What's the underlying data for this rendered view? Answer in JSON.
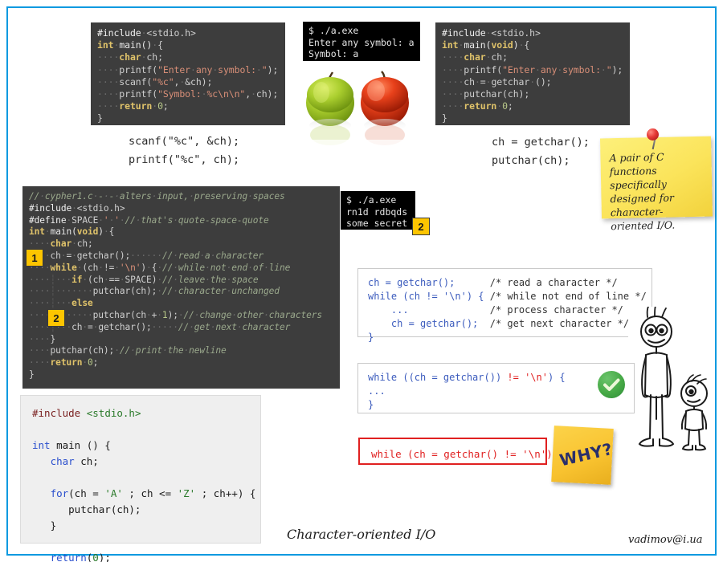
{
  "page": {
    "caption": "Character-oriented I/O",
    "credit": "vadimov@i.ua",
    "border_color": "#0c9ae0",
    "background": "#ffffff"
  },
  "code_blocks": {
    "scanf_program": {
      "name": "scanf-printf-program",
      "lines": [
        "#include <stdio.h>",
        "int main() {",
        "    char ch;",
        "    printf(\"Enter any symbol: \");",
        "    scanf(\"%c\", &ch);",
        "    printf(\"Symbol: %c\\n\\n\", ch);",
        "    return 0;",
        "}"
      ]
    },
    "getchar_program": {
      "name": "getchar-putchar-program",
      "lines": [
        "#include <stdio.h>",
        "int main(void) {",
        "    char ch;",
        "    printf(\"Enter any symbol: \");",
        "    ch = getchar ();",
        "    putchar(ch);",
        "    return 0;",
        "}"
      ]
    },
    "cypher_program": {
      "name": "cypher1-program",
      "lines": [
        "// cypher1.c -- alters input, preserving spaces",
        "#include <stdio.h>",
        "#define SPACE ' ' // that's quote-space-quote",
        "int main(void) {",
        "    char ch;",
        "    ch = getchar();      // read a character",
        "    while (ch != '\\n') { // while not end of line",
        "        if (ch == SPACE) // leave the space",
        "            putchar(ch); // character unchanged",
        "        else",
        "            putchar(ch + 1); // change other characters",
        "        ch = getchar();      // get next character",
        "    }",
        "    putchar(ch); // print the newline",
        "    return 0;",
        "}"
      ]
    },
    "for_loop_program": {
      "name": "for-loop-putchar-program",
      "lines": [
        "#include <stdio.h>",
        "",
        "int main () {",
        "   char ch;",
        "",
        "   for(ch = 'A' ; ch <= 'Z' ; ch++) {",
        "      putchar(ch);",
        "   }",
        "",
        "   return(0);",
        "}"
      ]
    }
  },
  "terminals": {
    "symbol_run": {
      "name": "terminal-symbol-run",
      "lines": [
        "$ ./a.exe",
        "Enter any symbol: a",
        "Symbol: a"
      ]
    },
    "cypher_run": {
      "name": "terminal-cypher-run",
      "lines": [
        "$ ./a.exe",
        "rn1d rdbqds",
        "some secret"
      ]
    }
  },
  "annotations": {
    "scanf_pair": {
      "name": "scanf-printf-annotation",
      "text": "scanf(\"%c\", &ch);\nprintf(\"%c\", ch);"
    },
    "getchar_pair": {
      "name": "getchar-putchar-annotation",
      "text": "ch = getchar();\nputchar(ch);"
    }
  },
  "pattern_box": {
    "name": "read-loop-pattern",
    "lines": [
      {
        "code": "ch = getchar();",
        "comment": "/* read a character */"
      },
      {
        "code": "while (ch != '\\n') {",
        "comment": "/* while not end of line */"
      },
      {
        "code": "    ...",
        "comment": "/* process character */"
      },
      {
        "code": "    ch = getchar();",
        "comment": "/* get next character */"
      },
      {
        "code": "}",
        "comment": ""
      }
    ]
  },
  "correct_box": {
    "name": "correct-while-form",
    "lines": [
      "while ((ch = getchar()) != '\\n') {",
      "...",
      "}"
    ],
    "status": "correct",
    "status_icon": "check-circle-icon",
    "status_color": "#46a946"
  },
  "wrong_box": {
    "name": "wrong-while-form",
    "text": "while (ch = getchar() != '\\n')",
    "border_color": "#e02020",
    "text_color": "#e02020"
  },
  "markers": [
    {
      "label": "1",
      "name": "marker-1-cypher"
    },
    {
      "label": "2",
      "name": "marker-2-cypher"
    },
    {
      "label": "2",
      "name": "marker-2-terminal"
    }
  ],
  "sticky_note": {
    "name": "sticky-note-c-functions",
    "text": "A pair of C functions specifically designed for character-oriented I/O.",
    "color": "#fbe45b",
    "pin_icon": "push-pin-icon"
  },
  "why_note": {
    "name": "sticky-note-why",
    "text": "WHY?",
    "color": "#f8c22f"
  },
  "images": {
    "apples": {
      "name": "apples-photo",
      "alt": "green apple and red apple",
      "green": "#a6c42a",
      "red": "#e63a1e"
    },
    "stick_figures": {
      "name": "stick-figures-drawing",
      "alt": "tall stick figure adult and small stick figure child"
    }
  }
}
